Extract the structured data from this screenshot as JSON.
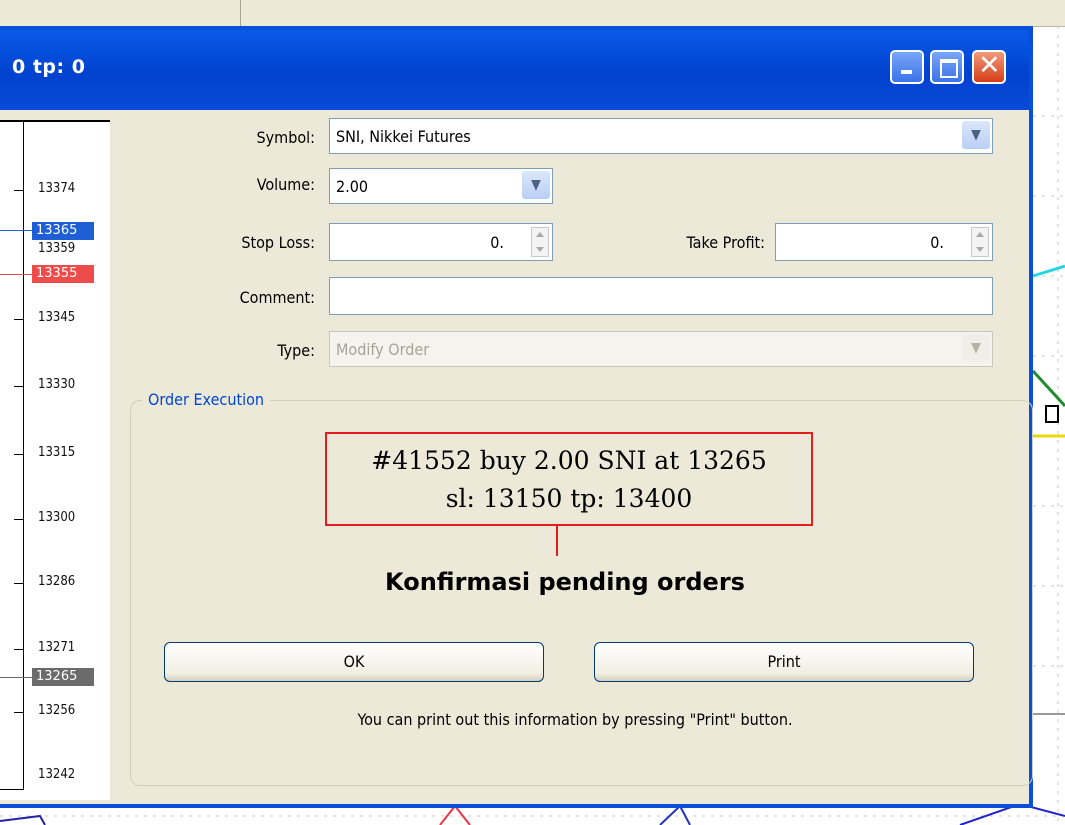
{
  "background": {
    "toolbar_text": "·· ·· ·· ··"
  },
  "window": {
    "title": "0 tp: 0",
    "controls": {
      "minimize": "minimize-icon",
      "maximize": "maximize-icon",
      "close": "close-icon"
    }
  },
  "price_axis": {
    "labels": [
      "13374",
      "13359",
      "13345",
      "13330",
      "13315",
      "13300",
      "13286",
      "13271",
      "13256",
      "13242"
    ],
    "highlights": [
      {
        "value": "13365",
        "color": "#1f5fd6"
      },
      {
        "value": "13355",
        "color": "#ee4b4b"
      },
      {
        "value": "13265",
        "color": "#6b6b6b"
      }
    ]
  },
  "form": {
    "symbol_label": "Symbol:",
    "symbol_value": "SNI, Nikkei Futures",
    "volume_label": "Volume:",
    "volume_value": "2.00",
    "stop_loss_label": "Stop Loss:",
    "stop_loss_value": "0.",
    "take_profit_label": "Take Profit:",
    "take_profit_value": "0.",
    "comment_label": "Comment:",
    "comment_value": "",
    "type_label": "Type:",
    "type_value": "Modify Order"
  },
  "execution": {
    "group_title": "Order Execution",
    "line1": "#41552 buy 2.00 SNI at 13265",
    "line2": "sl: 13150 tp: 13400",
    "annotation": "Konfirmasi pending orders",
    "ok_label": "OK",
    "print_label": "Print",
    "hint": "You can print out this information by pressing \"Print\" button."
  },
  "colors": {
    "titlebar": "#0a4fd8",
    "dialog_bg": "#ece9d8",
    "group_title": "#0046d5",
    "highlight_box": "#e31e1e"
  }
}
